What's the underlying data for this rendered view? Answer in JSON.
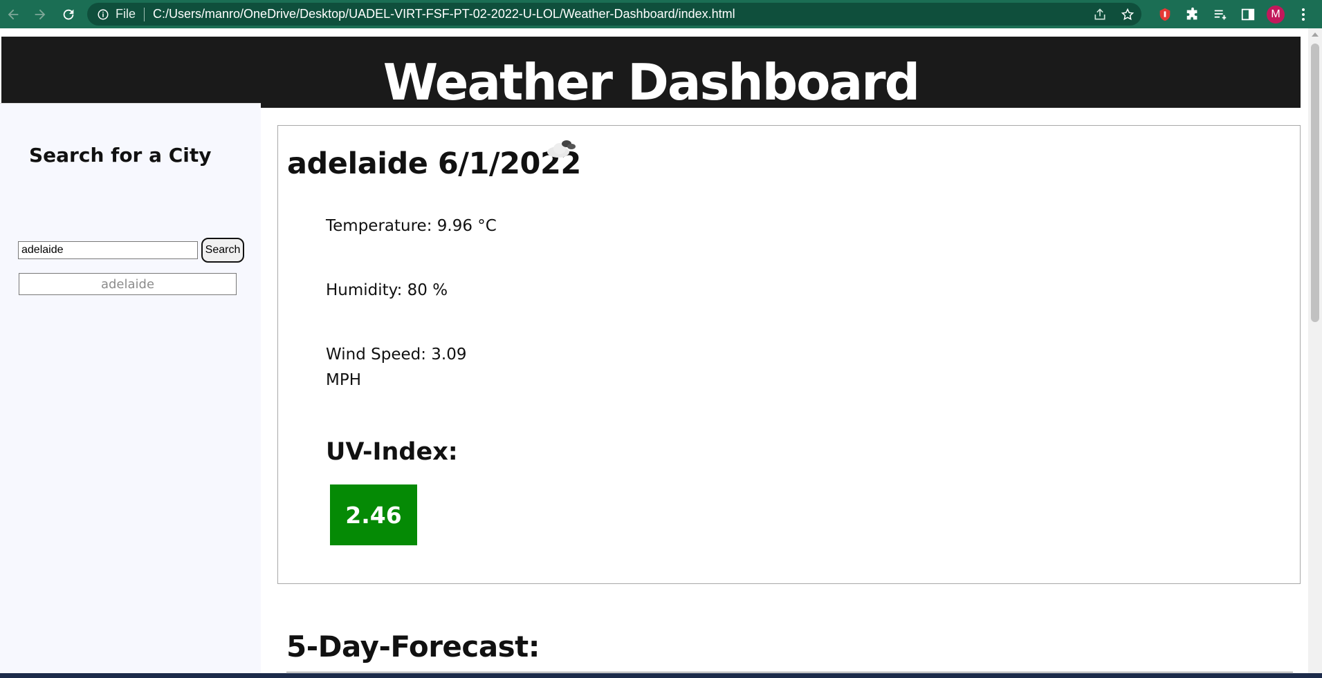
{
  "browser": {
    "file_label": "File",
    "url": "C:/Users/manro/OneDrive/Desktop/UADEL-VIRT-FSF-PT-02-2022-U-LOL/Weather-Dashboard/index.html",
    "profile_initial": "M",
    "toolbar_icons": [
      "back-icon",
      "forward-icon",
      "reload-icon",
      "site-info-icon",
      "share-icon",
      "bookmark-star-icon",
      "extension-red-icon",
      "extensions-puzzle-icon",
      "reading-list-icon",
      "side-panel-icon",
      "menu-dots-icon"
    ]
  },
  "header": {
    "title": "Weather Dashboard"
  },
  "sidebar": {
    "heading": "Search for a City",
    "search_value": "adelaide",
    "search_button": "Search",
    "history": [
      "adelaide"
    ]
  },
  "current": {
    "city_date": "adelaide 6/1/2022",
    "weather_icon": "cloud-icon",
    "temperature": "Temperature: 9.96 °C",
    "humidity": "Humidity: 80 %",
    "wind_line1": "Wind Speed: 3.09",
    "wind_line2": "MPH",
    "uv_label": "UV-Index:",
    "uv_value": "2.46",
    "uv_color": "#058a05"
  },
  "forecast": {
    "title": "5-Day-Forecast:"
  },
  "colors": {
    "chrome": "#1b6e54",
    "header_bg": "#1a1a1a",
    "sidebar_bg": "#f7f8fe"
  }
}
